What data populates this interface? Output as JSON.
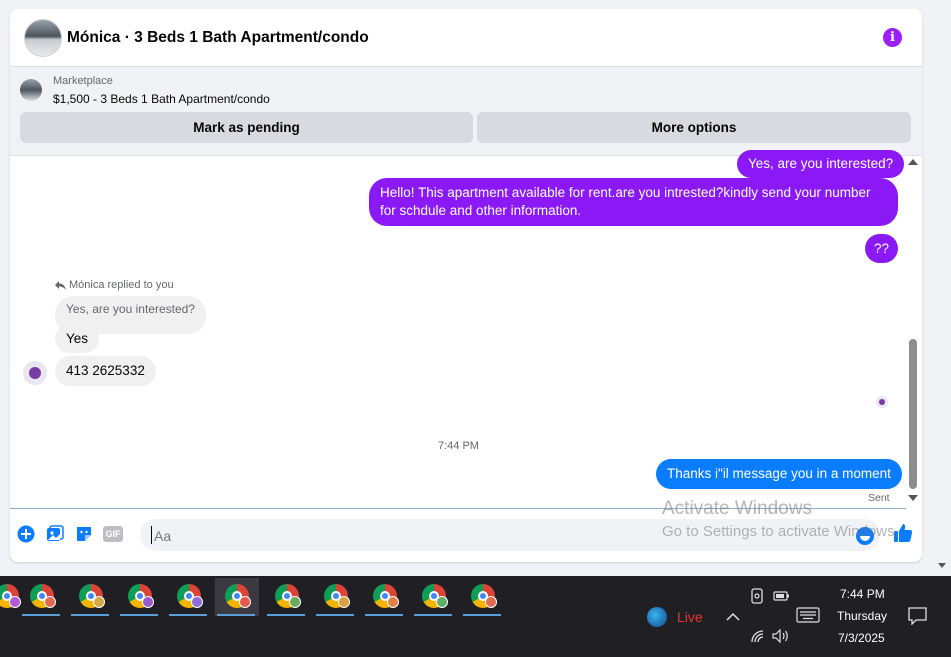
{
  "header": {
    "title": "Mónica · 3 Beds 1 Bath Apartment/condo",
    "info_icon_glyph": "i",
    "accent_color": "#9b1ef5"
  },
  "marketplace": {
    "label": "Marketplace",
    "listing": "$1,500 - 3 Beds 1 Bath Apartment/condo",
    "mark_pending": "Mark as pending",
    "more_options": "More options"
  },
  "messages": {
    "out1": "Yes, are you interested?",
    "out2": "Hello! This apartment available for rent.are you intrested?kindly send your number for schdule and other information.",
    "out3": "??",
    "reply_label": "Mónica replied to you",
    "quoted": "Yes, are you interested?",
    "in1": "Yes",
    "in2": "413 2625332",
    "timestamp": "7:44 PM",
    "out4": "Thanks i\"il message you in a moment",
    "status": "Sent"
  },
  "composer": {
    "placeholder": "Aa",
    "gif_label": "GIF"
  },
  "watermark": {
    "line1": "Activate Windows",
    "line2": "Go to Settings to activate Windows."
  },
  "taskbar": {
    "live_label": "Live",
    "time": "7:44 PM",
    "day": "Thursday",
    "date": "7/3/2025",
    "app_icon": "chrome-icon",
    "app_count": 10
  }
}
